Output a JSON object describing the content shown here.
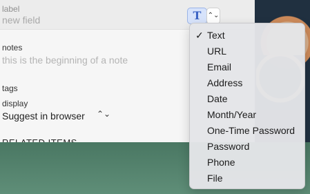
{
  "field": {
    "label_title": "label",
    "label_placeholder": "new field",
    "type_icon_glyph": "T",
    "stepper_glyph": "⌃⌄"
  },
  "notes": {
    "title": "notes",
    "placeholder": "this is the beginning of a note"
  },
  "tags": {
    "title": "tags"
  },
  "display": {
    "title": "display",
    "value": "Suggest in browser",
    "chevron": "⌃⌄"
  },
  "related": {
    "title": "RELATED ITEMS"
  },
  "menu": {
    "selected": "Text",
    "items": [
      {
        "label": "Text",
        "checked": true
      },
      {
        "label": "URL"
      },
      {
        "label": "Email"
      },
      {
        "label": "Address"
      },
      {
        "label": "Date"
      },
      {
        "label": "Month/Year"
      },
      {
        "label": "One-Time Password"
      },
      {
        "label": "Password"
      },
      {
        "label": "Phone"
      },
      {
        "label": "File"
      }
    ]
  }
}
